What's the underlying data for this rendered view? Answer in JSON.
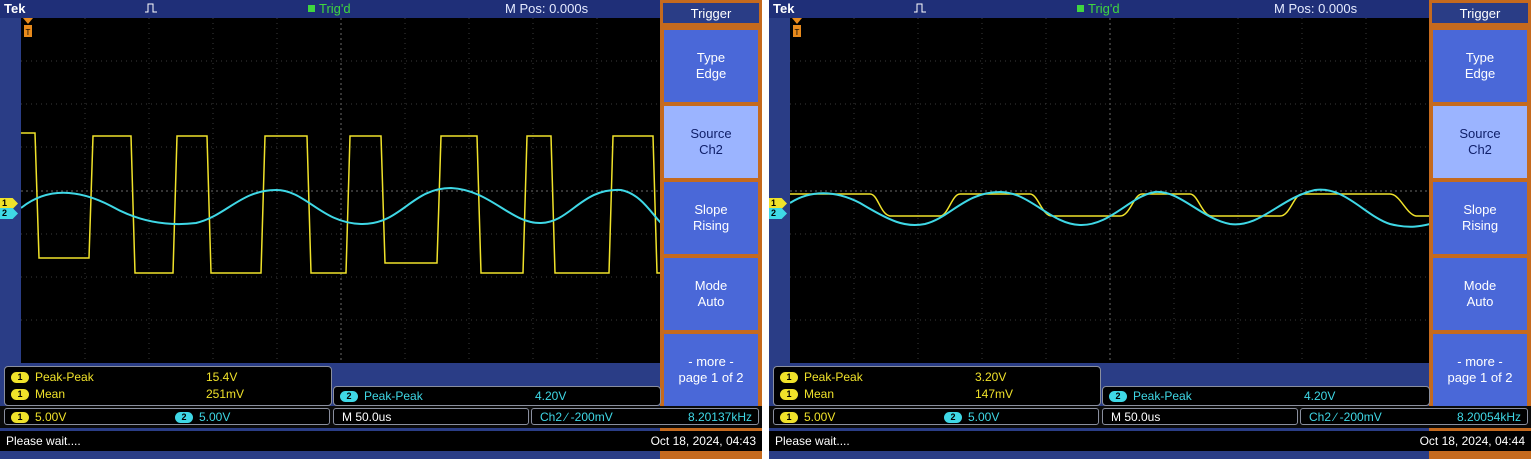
{
  "scopes": [
    {
      "brand": "Tek",
      "trigger_state": "Trig'd",
      "m_pos": "M Pos: 0.000s",
      "menu": {
        "title": "Trigger",
        "buttons": [
          {
            "line1": "Type",
            "line2": "Edge"
          },
          {
            "line1": "Source",
            "line2": "Ch2"
          },
          {
            "line1": "Slope",
            "line2": "Rising"
          },
          {
            "line1": "Mode",
            "line2": "Auto"
          },
          {
            "line1": "- more -",
            "line2": "page 1 of 2"
          }
        ]
      },
      "measurements": {
        "ch1": [
          {
            "label": "Peak-Peak",
            "value": "15.4V"
          },
          {
            "label": "Mean",
            "value": "251mV"
          }
        ],
        "ch2": {
          "label": "Peak-Peak",
          "value": "4.20V"
        }
      },
      "channels": {
        "ch1_scale": "5.00V",
        "ch2_scale": "5.00V"
      },
      "timebase": "M 50.0us",
      "trigger_info": "Ch2 ∕ -200mV",
      "frequency": "8.20137kHz",
      "status": "Please wait....",
      "datetime": "Oct 18, 2024, 04:43",
      "waveform_colors": {
        "ch1": "#f0e22a",
        "ch2": "#3fd8e6"
      }
    },
    {
      "brand": "Tek",
      "trigger_state": "Trig'd",
      "m_pos": "M Pos: 0.000s",
      "menu": {
        "title": "Trigger",
        "buttons": [
          {
            "line1": "Type",
            "line2": "Edge"
          },
          {
            "line1": "Source",
            "line2": "Ch2"
          },
          {
            "line1": "Slope",
            "line2": "Rising"
          },
          {
            "line1": "Mode",
            "line2": "Auto"
          },
          {
            "line1": "- more -",
            "line2": "page 1 of 2"
          }
        ]
      },
      "measurements": {
        "ch1": [
          {
            "label": "Peak-Peak",
            "value": "3.20V"
          },
          {
            "label": "Mean",
            "value": "147mV"
          }
        ],
        "ch2": {
          "label": "Peak-Peak",
          "value": "4.20V"
        }
      },
      "channels": {
        "ch1_scale": "5.00V",
        "ch2_scale": "5.00V"
      },
      "timebase": "M 50.0us",
      "trigger_info": "Ch2 ∕ -200mV",
      "frequency": "8.20054kHz",
      "status": "Please wait....",
      "datetime": "Oct 18, 2024, 04:44",
      "waveform_colors": {
        "ch1": "#f0e22a",
        "ch2": "#3fd8e6"
      }
    }
  ]
}
